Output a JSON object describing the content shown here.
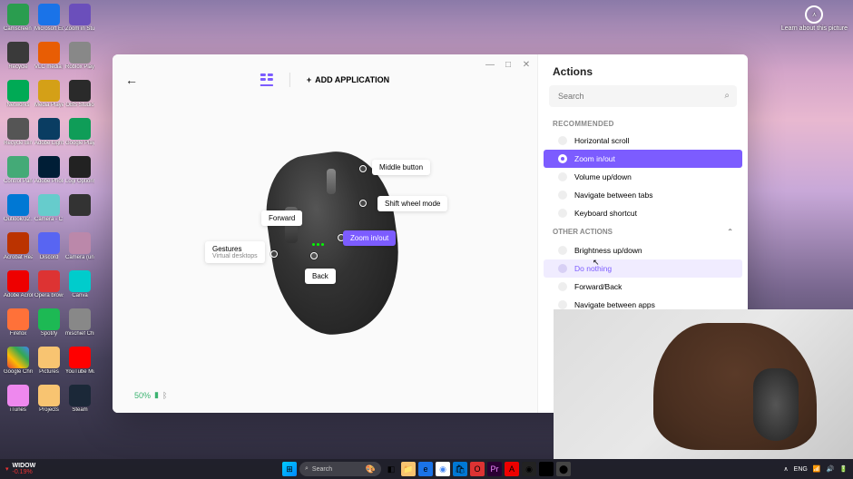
{
  "desktop_icons": [
    {
      "label": "Camscreen Whatsup",
      "bg": "#2a9d4f"
    },
    {
      "label": "Microsoft Edge",
      "bg": "#1a73e8"
    },
    {
      "label": "Zoom in Studio",
      "bg": "#6b4fbb"
    },
    {
      "label": "Recycle",
      "bg": "#3a3a3a"
    },
    {
      "label": "VLC media player",
      "bg": "#e85d04"
    },
    {
      "label": "Roblox Player",
      "bg": "#888"
    },
    {
      "label": "Networks",
      "bg": "#0a5"
    },
    {
      "label": "Media Player Classic",
      "bg": "#d4a017"
    },
    {
      "label": "OBS Studio",
      "bg": "#2a2a2a"
    },
    {
      "label": "Recycle Bin",
      "bg": "#555"
    },
    {
      "label": "Adobe Lightroom",
      "bg": "#0a3d62"
    },
    {
      "label": "Google Play Games beta",
      "bg": "#0f9d58"
    },
    {
      "label": "Control Panel",
      "bg": "#4a7"
    },
    {
      "label": "Adobe Photoshop.lnk",
      "bg": "#001e36"
    },
    {
      "label": "Logi Options+",
      "bg": "#222"
    },
    {
      "label": "Outlook/32…",
      "bg": "#0078d4"
    },
    {
      "label": "Camera - C…",
      "bg": "#6cc"
    },
    {
      "label": "",
      "bg": "#333"
    },
    {
      "label": "Acrobat Reader",
      "bg": "#b30"
    },
    {
      "label": "Discord",
      "bg": "#5865f2"
    },
    {
      "label": "Camera (unnamed)",
      "bg": "#b8a"
    },
    {
      "label": "Adobe Acrobat DC",
      "bg": "#e00"
    },
    {
      "label": "Opera browser",
      "bg": "#d33"
    },
    {
      "label": "Canva",
      "bg": "#0cc"
    },
    {
      "label": "Firefox",
      "bg": "#ff7139"
    },
    {
      "label": "Spotify",
      "bg": "#1db954"
    },
    {
      "label": "mischief Chrome",
      "bg": "#888"
    },
    {
      "label": "Google Chrome",
      "bg": "linear-gradient(45deg,#ea4335,#fbbc05,#34a853,#4285f4)"
    },
    {
      "label": "Pictures",
      "bg": "#f8c471"
    },
    {
      "label": "YouTube Music",
      "bg": "#f00"
    },
    {
      "label": "iTunes",
      "bg": "#e8e"
    },
    {
      "label": "Projects",
      "bg": "#f8c471"
    },
    {
      "label": "Steam",
      "bg": "#1b2838"
    }
  ],
  "widget": {
    "label": "Learn about this picture"
  },
  "app": {
    "add_app_label": "ADD APPLICATION",
    "callouts": {
      "middle": "Middle button",
      "shift": "Shift wheel mode",
      "zoom": "Zoom in/out",
      "back": "Back",
      "forward": "Forward",
      "gestures": "Gestures",
      "gestures_sub": "Virtual desktops"
    },
    "battery_pct": "50%"
  },
  "panel": {
    "title": "Actions",
    "search_placeholder": "Search",
    "recommended_label": "RECOMMENDED",
    "other_label": "OTHER ACTIONS",
    "recommended": [
      {
        "label": "Horizontal scroll",
        "selected": false
      },
      {
        "label": "Zoom in/out",
        "selected": true
      },
      {
        "label": "Volume up/down",
        "selected": false
      },
      {
        "label": "Navigate between tabs",
        "selected": false
      },
      {
        "label": "Keyboard shortcut",
        "selected": false
      }
    ],
    "other": [
      {
        "label": "Brightness up/down",
        "hover": false
      },
      {
        "label": "Do nothing",
        "hover": true
      },
      {
        "label": "Forward/Back",
        "hover": false
      },
      {
        "label": "Navigate between apps",
        "hover": false
      }
    ]
  },
  "taskbar": {
    "widow_label": "WIDOW",
    "widow_sub": "-0.19%",
    "search": "Search",
    "time": "",
    "tray": [
      "∧",
      "📶",
      "🔊",
      "🔋"
    ]
  }
}
